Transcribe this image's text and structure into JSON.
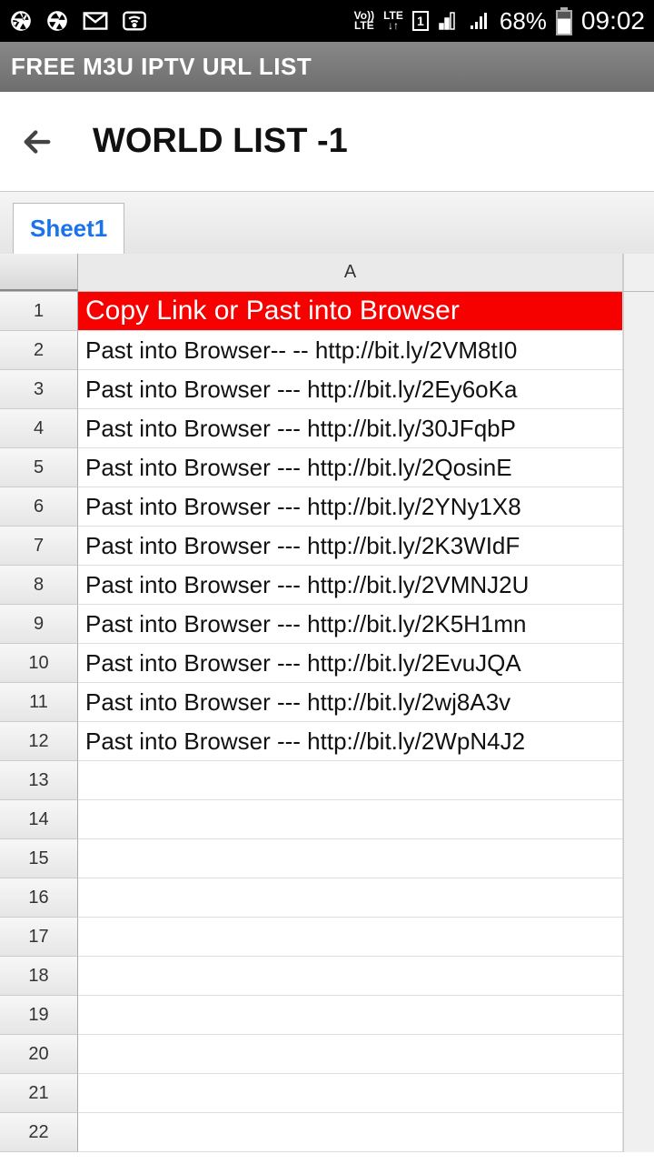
{
  "status": {
    "volte": "Vo))\nLTE",
    "lte": "LTE",
    "sim": "1",
    "battery_pct": "68%",
    "time": "09:02"
  },
  "app": {
    "title": "FREE M3U IPTV URL LIST"
  },
  "page": {
    "title": "WORLD LIST -1"
  },
  "tabs": {
    "active": "Sheet1"
  },
  "sheet": {
    "col_label": "A",
    "rows": [
      {
        "n": "1",
        "v": "Copy Link or Past into Browser",
        "header": true
      },
      {
        "n": "2",
        "v": "Past into Browser--   -- http://bit.ly/2VM8tI0"
      },
      {
        "n": "3",
        "v": "Past into Browser --- http://bit.ly/2Ey6oKa"
      },
      {
        "n": "4",
        "v": "Past into Browser --- http://bit.ly/30JFqbP"
      },
      {
        "n": "5",
        "v": "Past into Browser --- http://bit.ly/2QosinE"
      },
      {
        "n": "6",
        "v": "Past into Browser --- http://bit.ly/2YNy1X8"
      },
      {
        "n": "7",
        "v": "Past into Browser --- http://bit.ly/2K3WIdF"
      },
      {
        "n": "8",
        "v": "Past into Browser --- http://bit.ly/2VMNJ2U"
      },
      {
        "n": "9",
        "v": "Past into Browser --- http://bit.ly/2K5H1mn"
      },
      {
        "n": "10",
        "v": "Past into Browser --- http://bit.ly/2EvuJQA"
      },
      {
        "n": "11",
        "v": "Past into Browser --- http://bit.ly/2wj8A3v"
      },
      {
        "n": "12",
        "v": "Past into Browser --- http://bit.ly/2WpN4J2"
      },
      {
        "n": "13",
        "v": ""
      },
      {
        "n": "14",
        "v": ""
      },
      {
        "n": "15",
        "v": ""
      },
      {
        "n": "16",
        "v": ""
      },
      {
        "n": "17",
        "v": ""
      },
      {
        "n": "18",
        "v": ""
      },
      {
        "n": "19",
        "v": ""
      },
      {
        "n": "20",
        "v": ""
      },
      {
        "n": "21",
        "v": ""
      },
      {
        "n": "22",
        "v": ""
      }
    ]
  }
}
